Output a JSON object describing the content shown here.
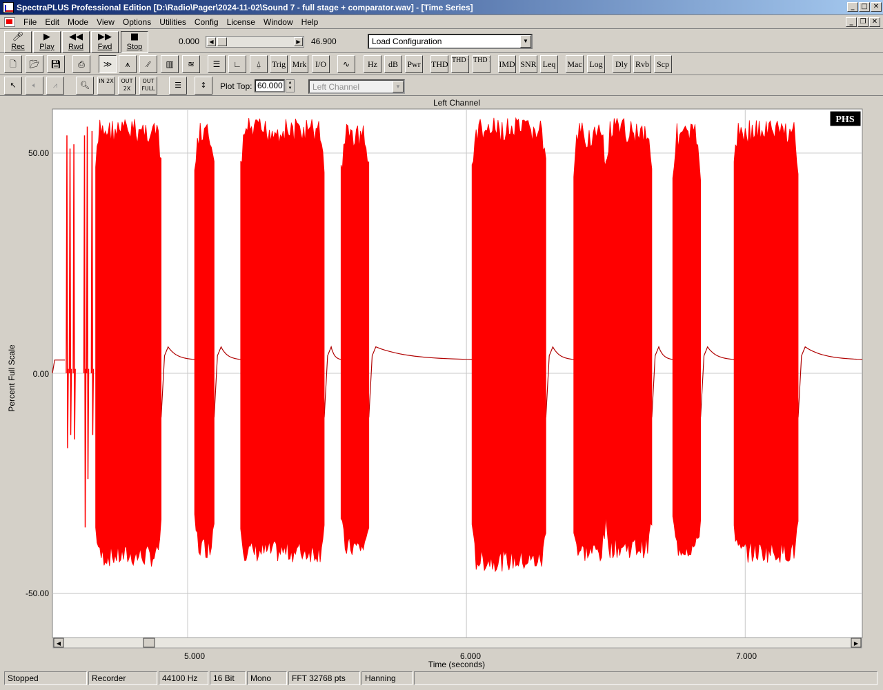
{
  "window": {
    "title": "SpectraPLUS Professional Edition [D:\\Radio\\Pager\\2024-11-02\\Sound 7 - full stage + comparator.wav] - [Time Series]",
    "min_glyph": "_",
    "max_glyph": "□",
    "close_glyph": "✕",
    "restore_glyph": "❐"
  },
  "menu": {
    "items": [
      "File",
      "Edit",
      "Mode",
      "View",
      "Options",
      "Utilities",
      "Config",
      "License",
      "Window",
      "Help"
    ]
  },
  "transport": {
    "rec": "Rec",
    "play": "Play",
    "rwd": "Rwd",
    "fwd": "Fwd",
    "stop": "Stop",
    "position_start": "0.000",
    "position_end": "46.900",
    "load_config": "Load Configuration"
  },
  "toolbar2": {
    "trig": "Trig",
    "mrk": "Mrk",
    "io": "I/O",
    "hz": "Hz",
    "db": "dB",
    "pwr": "Pwr",
    "thd": "THD",
    "thdn": "THD +N",
    "thdfreq": "THD Freq",
    "imd": "IMD",
    "snr": "SNR",
    "leq": "Leq",
    "mac": "Mac",
    "log": "Log",
    "dly": "Dly",
    "rvb": "Rvb",
    "scp": "Scp"
  },
  "toolbar3": {
    "zoom_in": "IN 2X",
    "zoom_out": "OUT 2X",
    "zoom_full": "OUT FULL",
    "plot_top_label": "Plot Top:",
    "plot_top_value": "60.000",
    "channel_select": "Left Channel"
  },
  "plot": {
    "title": "Left Channel",
    "logo": "PHS",
    "ylabel": "Percent Full Scale",
    "xlabel": "Time (seconds)",
    "yticks": [
      "50.00",
      "0.00",
      "-50.00"
    ],
    "xticks": [
      "5.000",
      "6.000",
      "7.000"
    ],
    "trace_color": "#ff0000",
    "decay_color": "#b00000"
  },
  "chart_data": {
    "type": "line",
    "title": "Left Channel",
    "xlabel": "Time (seconds)",
    "ylabel": "Percent Full Scale",
    "xlim": [
      4.515,
      7.42
    ],
    "ylim": [
      -60,
      60
    ],
    "grid": true,
    "bursts": [
      {
        "start": 4.67,
        "end": 4.905,
        "max": 58,
        "min": -44
      },
      {
        "start": 5.025,
        "end": 5.095,
        "max": 57,
        "min": -42
      },
      {
        "start": 5.19,
        "end": 5.49,
        "max": 58,
        "min": -43
      },
      {
        "start": 5.55,
        "end": 5.65,
        "max": 57,
        "min": -42
      },
      {
        "start": 6.02,
        "end": 6.285,
        "max": 58,
        "min": -45
      },
      {
        "start": 6.385,
        "end": 6.5,
        "max": 57,
        "min": -43
      },
      {
        "start": 6.5,
        "end": 6.665,
        "max": 58,
        "min": -42
      },
      {
        "start": 6.74,
        "end": 6.84,
        "max": 57,
        "min": -42
      },
      {
        "start": 6.96,
        "end": 7.19,
        "max": 58,
        "min": -43
      }
    ],
    "spikes": [
      {
        "t": 4.567,
        "max": 54,
        "min": -17
      },
      {
        "t": 4.578,
        "max": 51,
        "min": -14
      },
      {
        "t": 4.592,
        "max": 52,
        "min": -15
      },
      {
        "t": 4.63,
        "max": 54,
        "min": -35
      },
      {
        "t": 4.64,
        "max": 56,
        "min": -24
      },
      {
        "t": 4.657,
        "max": 55,
        "min": -14
      }
    ],
    "rest_level": 3,
    "peak_after_burst": 6.0
  },
  "status": {
    "state": "Stopped",
    "mode": "Recorder",
    "rate": "44100 Hz",
    "bits": "16 Bit",
    "channels": "Mono",
    "fft": "FFT 32768 pts",
    "window": "Hanning"
  }
}
